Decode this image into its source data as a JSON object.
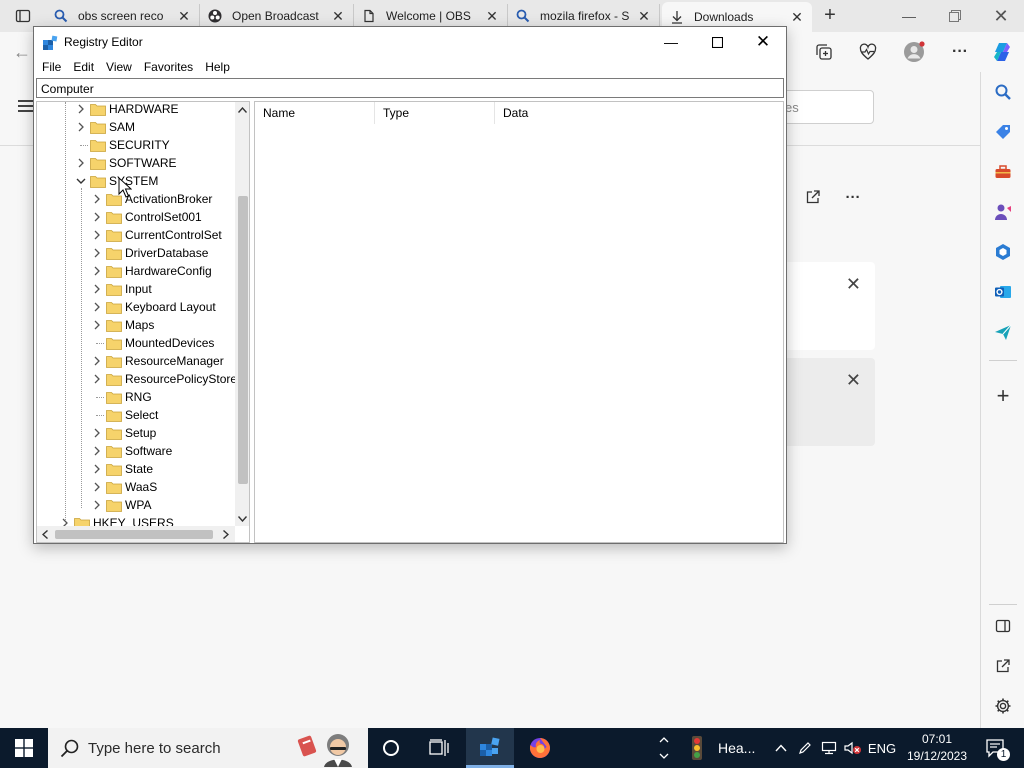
{
  "browser": {
    "tabs": [
      {
        "title": "obs screen reco",
        "icon": "search-icon"
      },
      {
        "title": "Open Broadcast",
        "icon": "obs-icon"
      },
      {
        "title": "Welcome | OBS",
        "icon": "page-icon"
      },
      {
        "title": "mozila firefox - S",
        "icon": "search-icon"
      },
      {
        "title": "Downloads",
        "icon": "download-icon",
        "active": true
      }
    ],
    "page": {
      "search_placeholder": "es"
    }
  },
  "regedit": {
    "title": "Registry Editor",
    "menu": [
      "File",
      "Edit",
      "View",
      "Favorites",
      "Help"
    ],
    "address": "Computer",
    "tree": {
      "hklm_children": [
        "HARDWARE",
        "SAM",
        "SECURITY",
        "SOFTWARE",
        "SYSTEM"
      ],
      "system_children": [
        "ActivationBroker",
        "ControlSet001",
        "CurrentControlSet",
        "DriverDatabase",
        "HardwareConfig",
        "Input",
        "Keyboard Layout",
        "Maps",
        "MountedDevices",
        "ResourceManager",
        "ResourcePolicyStore",
        "RNG",
        "Select",
        "Setup",
        "Software",
        "State",
        "WaaS",
        "WPA"
      ],
      "next_root": "HKEY_USERS"
    },
    "columns": [
      "Name",
      "Type",
      "Data"
    ]
  },
  "taskbar": {
    "search_placeholder": "Type here to search",
    "tray_app": "Hea...",
    "language": "ENG",
    "time": "07:01",
    "date": "19/12/2023",
    "notification_count": "1"
  },
  "colors": {
    "folder": "#f6d36b",
    "taskbar": "#0b1a2c",
    "accent": "#0067c0"
  }
}
